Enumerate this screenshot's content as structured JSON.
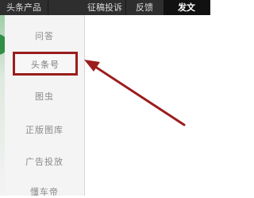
{
  "topbar": {
    "tabs": [
      {
        "label": "头条产品"
      },
      {
        "label": "征稿投诉"
      },
      {
        "label": "反馈"
      },
      {
        "label": "发文"
      }
    ],
    "active": "发文"
  },
  "sidebar": {
    "items": [
      {
        "label": "问答"
      },
      {
        "label": "头条号"
      },
      {
        "label": "图虫"
      },
      {
        "label": "正版图库"
      },
      {
        "label": "广告投放"
      },
      {
        "label": "懂车帝"
      }
    ],
    "highlighted": "头条号"
  },
  "annotation": {
    "arrow_color": "#9b1d1d",
    "highlight_color": "#9b1d1d"
  }
}
